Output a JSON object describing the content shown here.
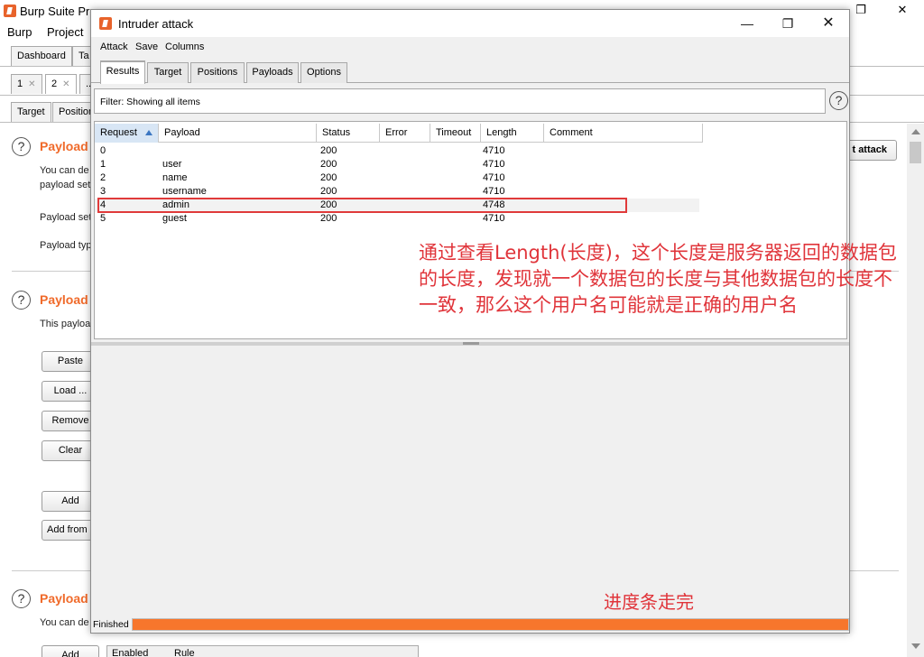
{
  "background": {
    "title": "Burp Suite Pro",
    "menus": [
      "Burp",
      "Project"
    ],
    "top_tabs": [
      "Dashboard",
      "Ta"
    ],
    "instance_tabs": [
      {
        "label": "1"
      },
      {
        "label": "2"
      },
      {
        "label": "..."
      }
    ],
    "sub_tabs": [
      "Target",
      "Position"
    ],
    "start_attack_label": "t attack",
    "sections": [
      {
        "title": "Payload",
        "lines": [
          "You can de",
          "payload set",
          "Payload set",
          "Payload typ"
        ]
      },
      {
        "title": "Payload",
        "lines": [
          "This payloa"
        ]
      },
      {
        "title": "Payload",
        "lines": [
          "You can de"
        ]
      }
    ],
    "buttons": [
      "Paste",
      "Load ...",
      "Remove",
      "Clear",
      "Add",
      "Add from",
      "Add"
    ],
    "bottom_table_headers": [
      "Enabled",
      "Rule"
    ]
  },
  "dialog": {
    "title": "Intruder attack",
    "menus": [
      "Attack",
      "Save",
      "Columns"
    ],
    "tabs": [
      "Results",
      "Target",
      "Positions",
      "Payloads",
      "Options"
    ],
    "active_tab": "Results",
    "filter_text": "Filter: Showing all items",
    "columns": [
      "Request",
      "Payload",
      "Status",
      "Error",
      "Timeout",
      "Length",
      "Comment"
    ],
    "rows": [
      {
        "request": "0",
        "payload": "",
        "status": "200",
        "error": "",
        "timeout": "",
        "length": "4710",
        "comment": ""
      },
      {
        "request": "1",
        "payload": "user",
        "status": "200",
        "error": "",
        "timeout": "",
        "length": "4710",
        "comment": ""
      },
      {
        "request": "2",
        "payload": "name",
        "status": "200",
        "error": "",
        "timeout": "",
        "length": "4710",
        "comment": ""
      },
      {
        "request": "3",
        "payload": "username",
        "status": "200",
        "error": "",
        "timeout": "",
        "length": "4710",
        "comment": ""
      },
      {
        "request": "4",
        "payload": "admin",
        "status": "200",
        "error": "",
        "timeout": "",
        "length": "4748",
        "comment": ""
      },
      {
        "request": "5",
        "payload": "guest",
        "status": "200",
        "error": "",
        "timeout": "",
        "length": "4710",
        "comment": ""
      }
    ],
    "status_label": "Finished",
    "progress_fraction": 1.0
  },
  "annotations": {
    "main": "通过查看Length(长度)，这个长度是服务器返回的数据包的长度，发现就一个数据包的长度与其他数据包的长度不一致，那么这个用户名可能就是正确的用户名",
    "progress": "进度条走完"
  },
  "colors": {
    "accent": "#f06a2a",
    "progress": "#f7762c",
    "annotation": "#e0343a"
  }
}
